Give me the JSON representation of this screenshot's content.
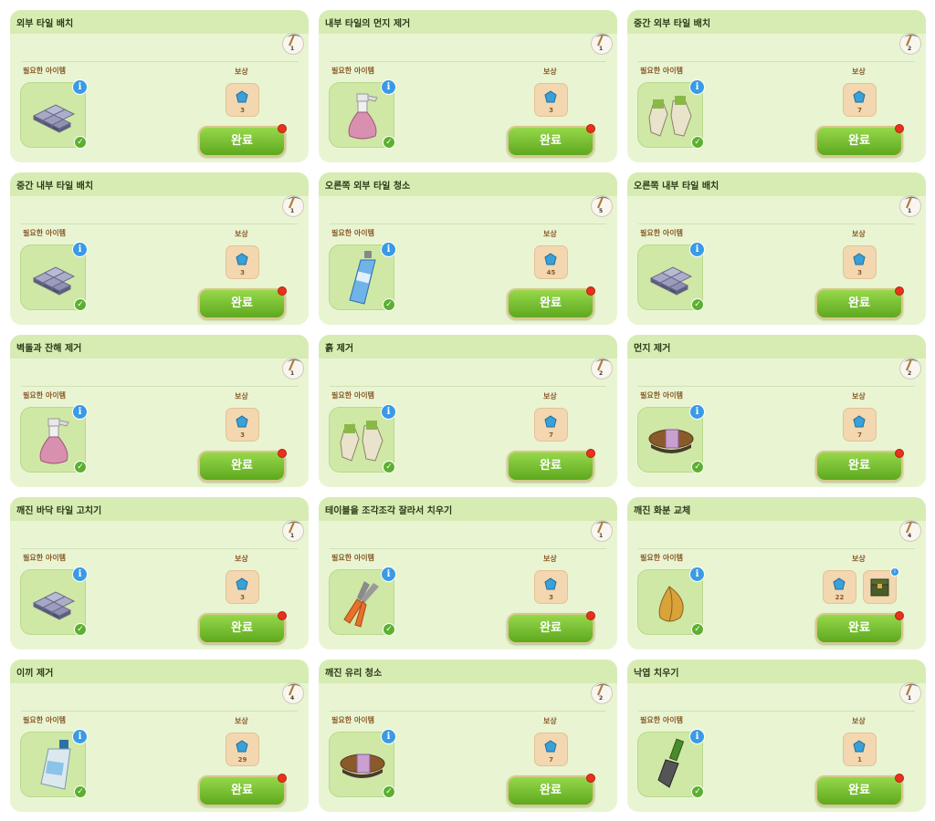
{
  "labels": {
    "required": "필요한 아이템",
    "reward": "보상",
    "complete": "완료"
  },
  "colors": {
    "card_bg": "#e9f5d2",
    "header_bg": "#d7ecb3",
    "button_green": "#6fba2a",
    "notify_red": "#e8321c",
    "gem_blue": "#3aa0d8"
  },
  "tasks": [
    {
      "title": "외부 타일 배치",
      "cost": "1",
      "item_icon": "stone-tiles-icon",
      "rewards": [
        {
          "type": "gem",
          "amount": "3"
        }
      ]
    },
    {
      "title": "내부 타일의 먼지 제거",
      "cost": "1",
      "item_icon": "spray-bottle-icon",
      "rewards": [
        {
          "type": "gem",
          "amount": "3"
        }
      ]
    },
    {
      "title": "중간 외부 타일 배치",
      "cost": "2",
      "item_icon": "work-gloves-icon",
      "rewards": [
        {
          "type": "gem",
          "amount": "7"
        }
      ]
    },
    {
      "title": "중간 내부 타일 배치",
      "cost": "1",
      "item_icon": "stone-tiles-icon",
      "rewards": [
        {
          "type": "gem",
          "amount": "3"
        }
      ]
    },
    {
      "title": "오른쪽 외부 타일 청소",
      "cost": "5",
      "item_icon": "cleaner-bottle-icon",
      "rewards": [
        {
          "type": "gem",
          "amount": "45"
        }
      ]
    },
    {
      "title": "오른쪽 내부 타일 배치",
      "cost": "1",
      "item_icon": "stone-tiles-icon",
      "rewards": [
        {
          "type": "gem",
          "amount": "3"
        }
      ]
    },
    {
      "title": "벽돌과 잔해 제거",
      "cost": "1",
      "item_icon": "spray-bottle-icon",
      "rewards": [
        {
          "type": "gem",
          "amount": "3"
        }
      ]
    },
    {
      "title": "흙 제거",
      "cost": "2",
      "item_icon": "work-gloves-icon",
      "rewards": [
        {
          "type": "gem",
          "amount": "7"
        }
      ]
    },
    {
      "title": "먼지 제거",
      "cost": "2",
      "item_icon": "scrub-brush-icon",
      "rewards": [
        {
          "type": "gem",
          "amount": "7"
        }
      ]
    },
    {
      "title": "깨진 바닥 타일 고치기",
      "cost": "1",
      "item_icon": "stone-tiles-icon",
      "rewards": [
        {
          "type": "gem",
          "amount": "3"
        }
      ]
    },
    {
      "title": "테이블을 조각조각 잘라서 치우기",
      "cost": "1",
      "item_icon": "pliers-icon",
      "rewards": [
        {
          "type": "gem",
          "amount": "3"
        }
      ]
    },
    {
      "title": "깨진 화분 교체",
      "cost": "4",
      "item_icon": "flower-bulb-icon",
      "rewards": [
        {
          "type": "gem",
          "amount": "22"
        },
        {
          "type": "chest"
        }
      ]
    },
    {
      "title": "이끼 제거",
      "cost": "4",
      "item_icon": "detergent-bottle-icon",
      "rewards": [
        {
          "type": "gem",
          "amount": "29"
        }
      ]
    },
    {
      "title": "깨진 유리 청소",
      "cost": "2",
      "item_icon": "scrub-brush-icon",
      "rewards": [
        {
          "type": "gem",
          "amount": "7"
        }
      ]
    },
    {
      "title": "낙엽 치우기",
      "cost": "1",
      "item_icon": "garden-trowel-icon",
      "rewards": [
        {
          "type": "gem",
          "amount": "1"
        }
      ]
    }
  ]
}
